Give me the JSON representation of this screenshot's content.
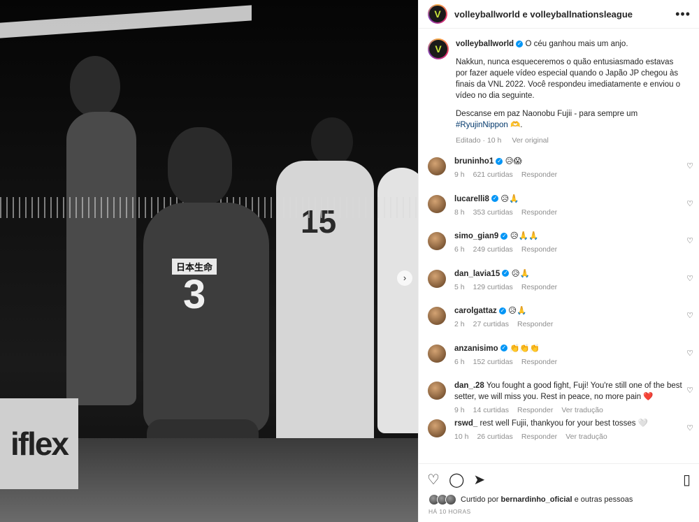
{
  "header": {
    "title": "volleyballworld e volleyballnationsleague",
    "more_icon": "more-horizontal-icon"
  },
  "photo": {
    "jersey_text": "日本生命",
    "jersey_number": "3",
    "opponent_number": "15",
    "ad_text": "iflex"
  },
  "caption": {
    "username": "volleyballworld",
    "line1": "O céu ganhou mais um anjo.",
    "para1": "Nakkun, nunca esqueceremos o quão entusiasmado estavas por fazer aquele vídeo especial quando o Japão JP chegou às finais da VNL 2022. Você respondeu imediatamente e enviou o vídeo no dia seguinte.",
    "para2_pre": "Descanse em paz Naonobu Fujii - para sempre um",
    "hashtag": "#RyujinNippon",
    "para2_post": " 🫶.",
    "edited": "Editado · 10 h",
    "see_original": "Ver original"
  },
  "comments": [
    {
      "user": "bruninho1",
      "verified": true,
      "text": "😥😱",
      "time": "9 h",
      "likes": "621 curtidas",
      "reply": "Responder",
      "translate": ""
    },
    {
      "user": "lucarelli8",
      "verified": true,
      "text": "😥🙏",
      "time": "8 h",
      "likes": "353 curtidas",
      "reply": "Responder",
      "translate": ""
    },
    {
      "user": "simo_gian9",
      "verified": true,
      "text": "😥🙏🙏",
      "time": "6 h",
      "likes": "249 curtidas",
      "reply": "Responder",
      "translate": ""
    },
    {
      "user": "dan_lavia15",
      "verified": true,
      "text": "😥🙏",
      "time": "5 h",
      "likes": "129 curtidas",
      "reply": "Responder",
      "translate": ""
    },
    {
      "user": "carolgattaz",
      "verified": true,
      "text": "😥🙏",
      "time": "2 h",
      "likes": "27 curtidas",
      "reply": "Responder",
      "translate": ""
    },
    {
      "user": "anzanisimo",
      "verified": true,
      "text": "👏👏👏",
      "time": "6 h",
      "likes": "152 curtidas",
      "reply": "Responder",
      "translate": ""
    },
    {
      "user": "dan_.28",
      "verified": false,
      "text": "You fought a good fight, Fuji! You're still one of the best setter, we will miss you. Rest in peace, no more pain ❤️",
      "time": "9 h",
      "likes": "14 curtidas",
      "reply": "Responder",
      "translate": "Ver tradução"
    },
    {
      "user": "rswd_",
      "verified": false,
      "text": "rest well Fujii, thankyou for your best tosses 🤍",
      "time": "10 h",
      "likes": "26 curtidas",
      "reply": "Responder",
      "translate": "Ver tradução"
    }
  ],
  "actions": {
    "like_icon": "heart-icon",
    "comment_icon": "comment-icon",
    "share_icon": "share-icon",
    "save_icon": "bookmark-icon"
  },
  "likes_line": {
    "prefix": "Curtido por",
    "user": "bernardinho_oficial",
    "suffix": "e outras pessoas"
  },
  "timestamp": "HÁ 10 HORAS",
  "colors": {
    "verified": "#0095f6",
    "hashtag": "#00376b",
    "meta": "#8e8e8e",
    "accent_logo": "#c7e43b"
  }
}
